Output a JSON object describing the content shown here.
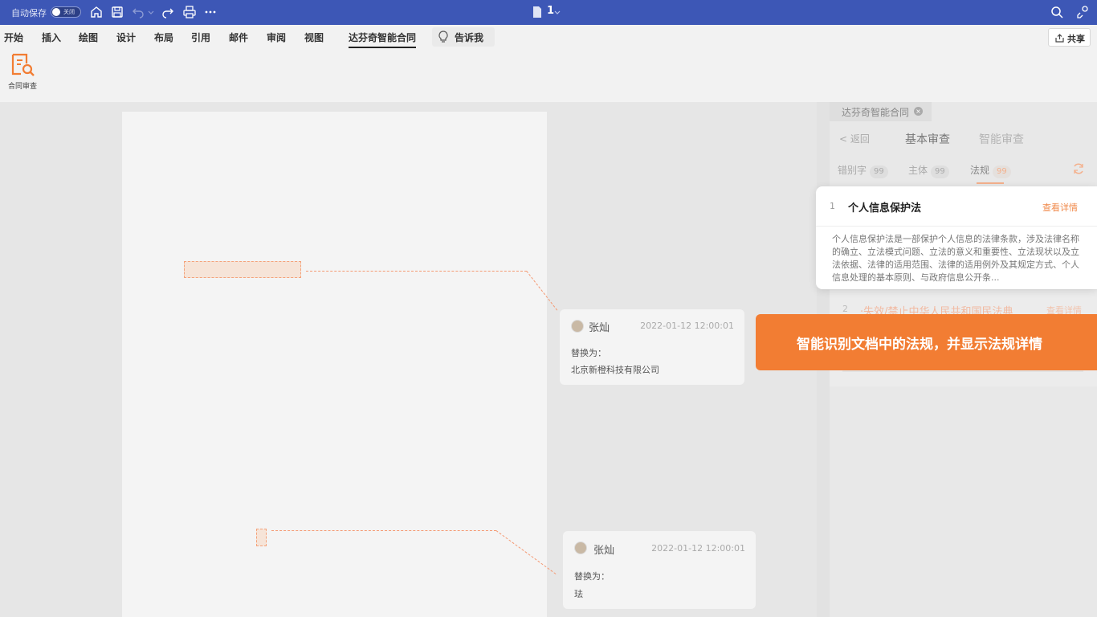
{
  "titlebar": {
    "autosave_label": "自动保存",
    "toggle_state": "关闭",
    "doc_title": "1"
  },
  "ribbon": {
    "tabs": [
      "开始",
      "插入",
      "绘图",
      "设计",
      "布局",
      "引用",
      "邮件",
      "审阅",
      "视图",
      "达芬奇智能合同"
    ],
    "tell_me": "告诉我",
    "share": "共享",
    "contract_review": "合同审查"
  },
  "comments": [
    {
      "name": "张灿",
      "time": "2022-01-12 12:00:01",
      "label": "替换为：",
      "value": "北京新橙科技有限公司"
    },
    {
      "name": "张灿",
      "time": "2022-01-12 12:00:01",
      "label": "替换为：",
      "value": "珐"
    }
  ],
  "panel": {
    "tab_title": "达芬奇智能合同",
    "close": "×",
    "back": "< 返回",
    "mode_basic": "基本审查",
    "mode_smart": "智能审查",
    "categories": [
      {
        "label": "错别字",
        "count": "99"
      },
      {
        "label": "主体",
        "count": "99"
      },
      {
        "label": "法规",
        "count": "99"
      }
    ],
    "items": [
      {
        "num": "1",
        "title": "个人信息保护法",
        "link": "查看详情",
        "desc": "个人信息保护法是一部保护个人信息的法律条款，涉及法律名称的确立、立法模式问题、立法的意义和重要性、立法现状以及立法依据、法律的适用范围、法律的适用例外及其规定方式、个人信息处理的基本原则、与政府信息公开条..."
      },
      {
        "num": "2",
        "title": "·失效/禁止中华人民共和国民法典",
        "link": "查看详情"
      }
    ]
  },
  "callout": "智能识别文档中的法规，并显示法规详情",
  "colors": {
    "brand": "#3d57b6",
    "accent": "#f27d33"
  }
}
